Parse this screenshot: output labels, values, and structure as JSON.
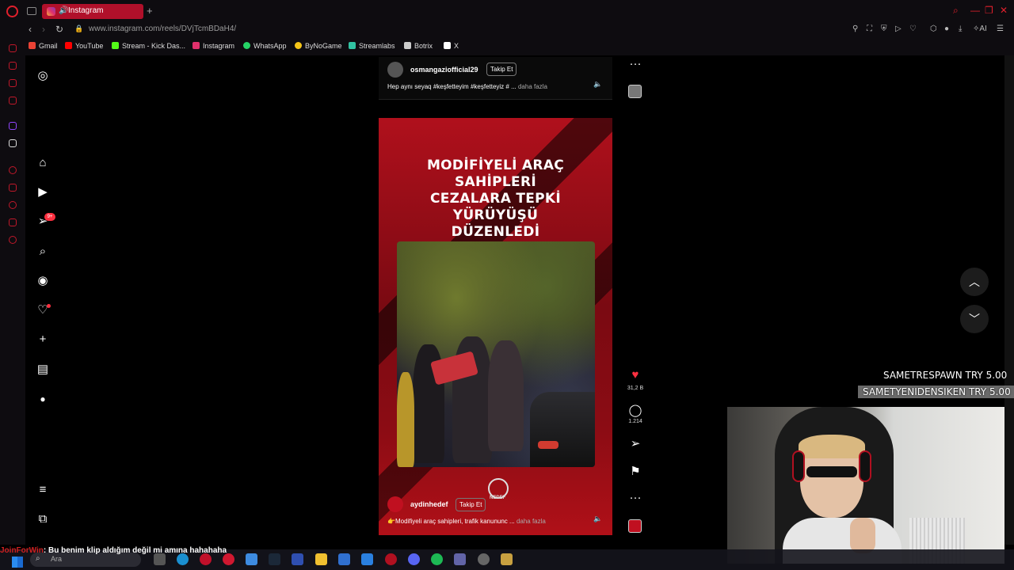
{
  "browser": {
    "tab_title": "Instagram",
    "url": "www.instagram.com/reels/DVjTcmBDaH4/"
  },
  "bookmarks": [
    {
      "label": "Gmail",
      "color": "#ea4335"
    },
    {
      "label": "YouTube",
      "color": "#ff0000"
    },
    {
      "label": "Stream - Kick Das...",
      "color": "#53fc18"
    },
    {
      "label": "Instagram",
      "color": "#e1306c"
    },
    {
      "label": "WhatsApp",
      "color": "#25d366"
    },
    {
      "label": "ByNoGame",
      "color": "#f5c518"
    },
    {
      "label": "Streamlabs",
      "color": "#31c3a2"
    },
    {
      "label": "Botrix",
      "color": "#cccccc"
    },
    {
      "label": "X",
      "color": "#ffffff"
    }
  ],
  "prev_reel": {
    "username": "osmangaziofficial29",
    "follow": "Takip Et",
    "caption": "Hep aynı seyaq #keşfetteyim #keşfetteyiz # ...",
    "more": "daha fazla"
  },
  "reel": {
    "headline_1": "MODİFİYELİ ARAÇ SAHİPLERİ",
    "headline_2": "CEZALARA TEPKİ YÜRÜYÜŞÜ",
    "headline_3": "DÜZENLEDİ",
    "logo_text": "NEDEF",
    "username": "aydinhedef",
    "follow": "Takip Et",
    "caption": "👉Modifiyeli araç sahipleri, trafik kanununc ...",
    "more": "daha fazla",
    "likes": "31,2 B",
    "comments": "1.214"
  },
  "nav": {
    "notif_badge": "9+"
  },
  "overlay": {
    "donation_1": "SAMETRESPAWN  TRY 5.00",
    "donation_2": "SAMETYENIDENSIKEN  TRY 5.00",
    "chat_user": "JoinForWin",
    "chat_message": ": Bu benim klip aldığım değil mi amına hahahaha"
  },
  "taskbar": {
    "search_placeholder": "Ara"
  }
}
